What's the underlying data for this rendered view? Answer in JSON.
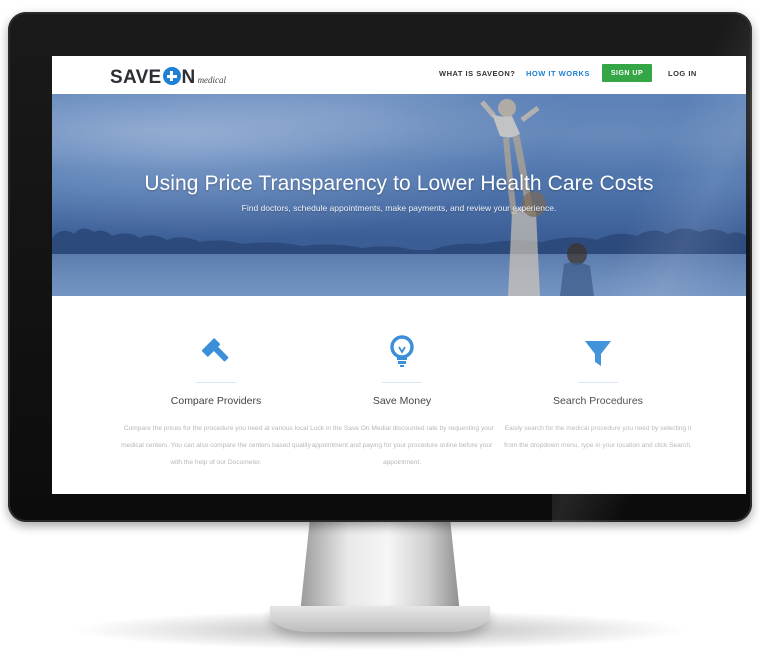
{
  "logo": {
    "word_left": "SAVE",
    "word_right": "N",
    "sub": "medical"
  },
  "nav": {
    "what_is": "WHAT IS SAVEON?",
    "how_it_works": "HOW IT WORKS",
    "sign_up": "SIGN UP",
    "log_in": "LOG IN"
  },
  "hero": {
    "title": "Using Price Transparency to Lower Health Care Costs",
    "subtitle": "Find doctors, schedule appointments, make payments, and review your experience."
  },
  "features": [
    {
      "icon": "gavel-icon",
      "title": "Compare Providers",
      "description": "Compare the prices for the procedure you need at various local medical centers. You can also compare the centers based quality with the help of our Docometer."
    },
    {
      "icon": "lightbulb-icon",
      "title": "Save Money",
      "description": "Lock in the Save On Medial discounted rate by requesting your appointment and paying for your procedure online before your appointment."
    },
    {
      "icon": "filter-icon",
      "title": "Search Procedures",
      "description": "Easily search for the medical procedure you need by selecting it from the dropdown menu, type in your location and click Search."
    }
  ],
  "colors": {
    "accent_blue": "#1d80d4",
    "signup_green": "#35a645",
    "icon_blue": "#3a8fd8"
  }
}
